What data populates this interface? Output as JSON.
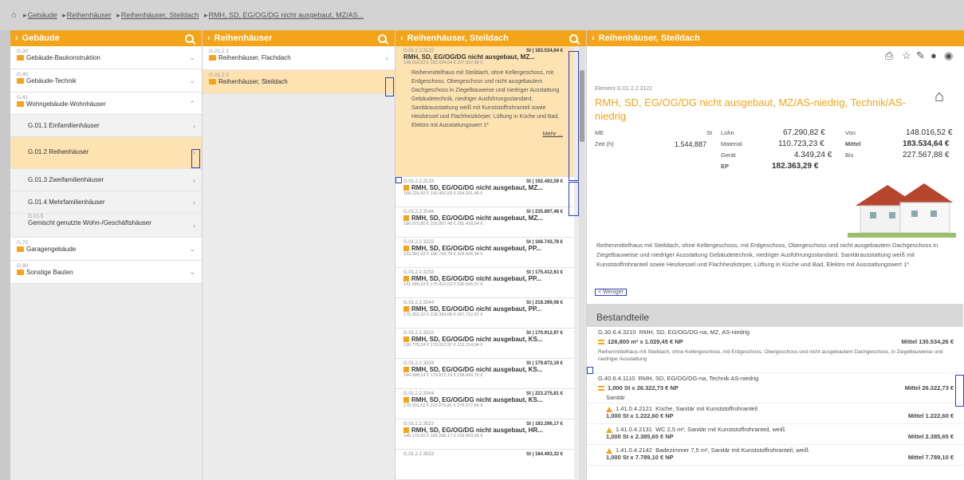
{
  "breadcrumb": {
    "items": [
      "Gebäude",
      "Reihenhäuser",
      "Reihenhäuser, Steildach",
      "RMH, SD, EG/OG/DG nicht ausgebaut, MZ/AS..."
    ]
  },
  "panel1": {
    "title": "Gebäude",
    "items": [
      {
        "code": "G.30",
        "label": "Gebäude-Baukonstruktion",
        "chev": "⌄"
      },
      {
        "code": "G.40",
        "label": "Gebäude-Technik",
        "chev": "⌄"
      },
      {
        "code": "G.41",
        "label": "Wohngebäude-Wohnhäuser",
        "chev": "⌃"
      }
    ],
    "subitems": [
      {
        "label": "G.01.1  Einfamilienhäuser"
      },
      {
        "label": "G.01.2  Reihenhäuser"
      },
      {
        "label": "G.01.3  Zweifamilienhäuser"
      },
      {
        "label": "G.01.4  Mehrfamilienhäuser"
      },
      {
        "code": "G.01.5",
        "label": "Gemischt genutzte Wohn-/Geschäftshäuser"
      }
    ],
    "items2": [
      {
        "code": "G.70",
        "label": "Garagengebäude"
      },
      {
        "code": "G.90",
        "label": "Sonstige Bauten"
      }
    ]
  },
  "panel2": {
    "title": "Reihenhäuser",
    "items": [
      {
        "code": "G.01.2.1",
        "label": "Reihenhäuser, Flachdach"
      },
      {
        "code": "G.01.2.2",
        "label": "Reihenhäuser, Steildach"
      }
    ]
  },
  "panel3": {
    "title": "Reihenhäuser, Steildach",
    "items": [
      {
        "code": "G.01.2.2.3122",
        "price": "St | 183.534,64 €",
        "name": "RMH, SD, EG/OG/DG nicht ausgebaut, MZ...",
        "range": "148.016,52 €   183.534,64 €   227.567,88 €"
      },
      {
        "code": "G.01.2.2.3133",
        "price": "St | 192.492,59 €",
        "name": "RMH, SD, EG/OG/DG nicht ausgebaut, MZ...",
        "range": "158.226,42 €   192.492,59 €   254.201,46 €"
      },
      {
        "code": "G.01.2.2.3144",
        "price": "St | 235.897,48 €",
        "name": "RMH, SD, EG/OG/DG nicht ausgebaut, MZ...",
        "range": "180.075,80 €   235.897,48 €   281.429,54 €"
      },
      {
        "code": "G.01.2.2.3222",
        "price": "St | 166.743,78 €",
        "name": "RMH, SD, EG/OG/DG nicht ausgebaut, PP...",
        "range": "133.991,03 €   166.743,78 €   204.606,94 €"
      },
      {
        "code": "G.01.2.2.3233",
        "price": "St | 175.412,63 €",
        "name": "RMH, SD, EG/OG/DG nicht ausgebaut, PP...",
        "range": "141.995,63 €   175.412,63 €   230.945,07 €"
      },
      {
        "code": "G.01.2.2.3244",
        "price": "St | 218.399,08 €",
        "name": "RMH, SD, EG/OG/DG nicht ausgebaut, PP...",
        "range": "175.392,22 €   218.399,08 €   267.712,87 €"
      },
      {
        "code": "G.01.2.2.3322",
        "price": "St | 170.912,97 €",
        "name": "RMH, SD, EG/OG/DG nicht ausgebaut, KS...",
        "range": "136.778,24 €   170.912,97 €   212.214,94 €"
      },
      {
        "code": "G.01.2.2.3333",
        "price": "St | 179.872,19 €",
        "name": "RMH, SD, EG/OG/DG nicht ausgebaut, KS...",
        "range": "144.998,14 €   179.872,19 €   238.849,76 €"
      },
      {
        "code": "G.01.2.2.3344",
        "price": "St | 223.275,81 €",
        "name": "RMH, SD, EG/OG/DG nicht ausgebaut, KS...",
        "range": "178.931,52 €   223.275,81 €   276.077,86 €"
      },
      {
        "code": "G.01.2.2.3522",
        "price": "St | 183.296,17 €",
        "name": "RMH, SD, EG/OG/DG nicht ausgebaut, HR...",
        "range": "146.176,65 €   183.296,17 €   219.433,95 €"
      },
      {
        "code": "G.01.2.2.3533",
        "price": "St | 184.493,32 €",
        "name": "",
        "range": ""
      }
    ],
    "selected_desc": "Reihenmittelhaus mit Steildach, ohne Kellergeschoss, mit Erdgeschoss, Obergeschoss und nicht ausgebautem Dachgeschoss in Ziegelbauweise und niedriger Ausstattung Gebäudetechnik, niedriger Ausführungsstandard, Sanitärausstattung weiß mit Kunststoffrohranteil sowie Heizkessel und Flachheizkörper, Lüftung in Küche und Bad, Elektro mit Ausstattungswert 1*",
    "mehr": "Mehr ..."
  },
  "panel4": {
    "title": "Reihenhäuser, Steildach",
    "element_code": "Element G.01.2.2.3122",
    "element_title": "RMH, SD, EG/OG/DG nicht ausgebaut, MZ/AS-niedrig, Technik/AS-niedrig",
    "me": {
      "label": "ME",
      "value": "St"
    },
    "zeit": {
      "label": "Zeit (h)",
      "value": "1.544,887"
    },
    "costs": [
      {
        "label": "Lohn",
        "value": "67.290,82 €"
      },
      {
        "label": "Material",
        "value": "110.723,23 €"
      },
      {
        "label": "Gerät",
        "value": "4.349,24 €"
      },
      {
        "label": "EP",
        "value": "182.363,29 €"
      }
    ],
    "range": [
      {
        "label": "Von",
        "value": "148.016,52 €"
      },
      {
        "label": "Mittel",
        "value": "183.534,64 €"
      },
      {
        "label": "Bis",
        "value": "227.567,88 €"
      }
    ],
    "description": "Reihenmittelhaus mit Steildach, ohne Kellergeschoss, mit Erdgeschoss, Obergeschoss und nicht ausgebautem Dachgeschoss in Ziegelbauweise und niedriger Ausstattung Gebäudetechnik, niedriger Ausführungsstandard, Sanitärausstattung weiß mit Kunststoffrohranteil sowie Heizkessel und Flachheizkörper, Lüftung in Küche und Bad, Elektro mit Ausstattungswert 1*",
    "weniger": "< Weniger",
    "bestandteile_title": "Bestandteile",
    "bestandteile": [
      {
        "code": "G.30.6.4.3210",
        "name": "RMH, SD, EG/OG/DG-na, MZ, AS-niedrig",
        "qty": "126,800 m² x 1.029,45 € NP",
        "mittel": "Mittel 130.534,26 €",
        "desc": "Reihenmittelhaus mit Steildach, ohne Kellergeschoss, mit Erdgeschoss, Obergeschoss und nicht ausgebautem Dachgeschoss, in Ziegelbauweise und niedriger Ausstattung"
      },
      {
        "code": "G.40.6.4.1110",
        "name": "RMH, SD, EG/OG/DG-na, Technik AS-niedrig",
        "qty": "1,000 St x 26.322,73 € NP",
        "mittel": "Mittel 26.322,73 €",
        "sub": "Sanitär"
      },
      {
        "code": "1.41.0.4.2121",
        "name": "Küche, Sanitär mit Kunststoffrohranteil",
        "qty": "1,000 St x 1.222,60 € NP",
        "mittel": "Mittel 1.222,60 €"
      },
      {
        "code": "1.41.0.4.2131",
        "name": "WC 2,5 m², Sanitär mit Kunststoffrohranteil, weiß",
        "qty": "1,000 St x 2.385,65 € NP",
        "mittel": "Mittel 2.385,65 €"
      },
      {
        "code": "1.41.0.4.2142",
        "name": "Badezimmer 7,5 m², Sanitär mit Kunststoffrohranteil, weiß",
        "qty": "1,000 St x 7.789,10 € NP",
        "mittel": "Mittel 7.789,10 €"
      }
    ]
  },
  "colors": {
    "accent": "#f4a418",
    "highlight": "#2b3fc9",
    "selected": "#fde2b2"
  },
  "icons": [
    "home-icon",
    "search-icon",
    "chevron-left-icon",
    "chevron-right-icon",
    "folder-icon",
    "print-icon",
    "star-icon",
    "edit-icon",
    "info-icon",
    "comment-icon",
    "house-icon"
  ]
}
